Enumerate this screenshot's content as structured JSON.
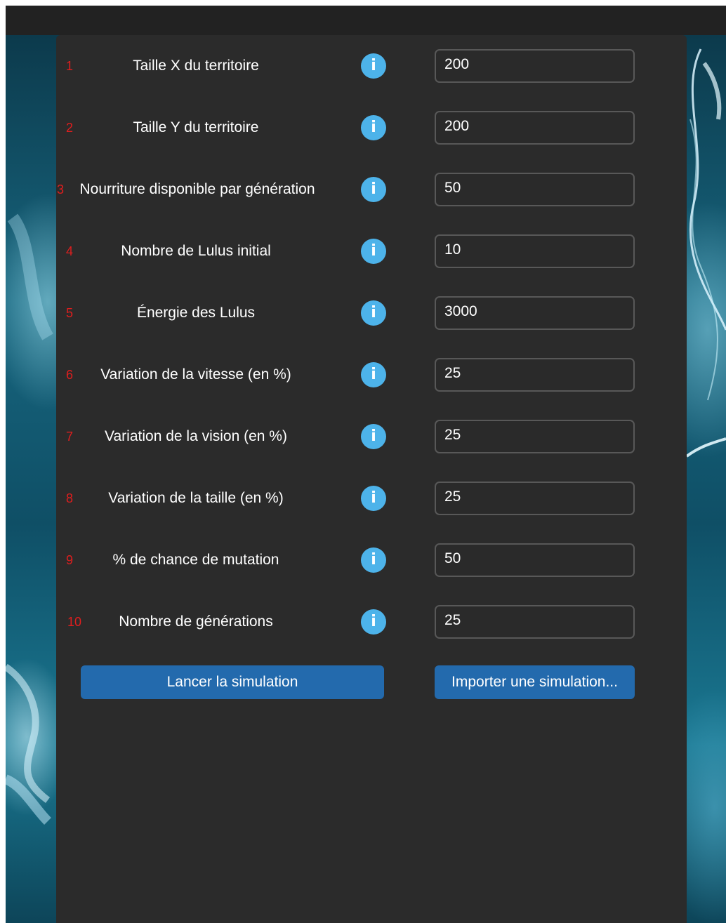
{
  "form": {
    "fields": [
      {
        "number": "1",
        "label": "Taille X du territoire",
        "value": "200"
      },
      {
        "number": "2",
        "label": "Taille Y du territoire",
        "value": "200"
      },
      {
        "number": "3",
        "label": "Nourriture disponible par génération",
        "value": "50"
      },
      {
        "number": "4",
        "label": "Nombre de Lulus initial",
        "value": "10"
      },
      {
        "number": "5",
        "label": "Énergie des Lulus",
        "value": "3000"
      },
      {
        "number": "6",
        "label": "Variation de la vitesse (en %)",
        "value": "25"
      },
      {
        "number": "7",
        "label": "Variation de la vision (en %)",
        "value": "25"
      },
      {
        "number": "8",
        "label": "Variation de la taille (en %)",
        "value": "25"
      },
      {
        "number": "9",
        "label": "% de chance de mutation",
        "value": "50"
      },
      {
        "number": "10",
        "label": "Nombre de générations",
        "value": "25"
      }
    ],
    "info_icon_glyph": "i",
    "info_icon": "info-icon",
    "buttons": {
      "launch_label": "Lancer la simulation",
      "import_label": "Importer une simulation..."
    }
  },
  "colors": {
    "panel_bg": "#2b2b2b",
    "number_color": "#e01e1e",
    "info_icon_color": "#4db3ea",
    "button_color": "#236aad",
    "field_border": "#585858"
  }
}
